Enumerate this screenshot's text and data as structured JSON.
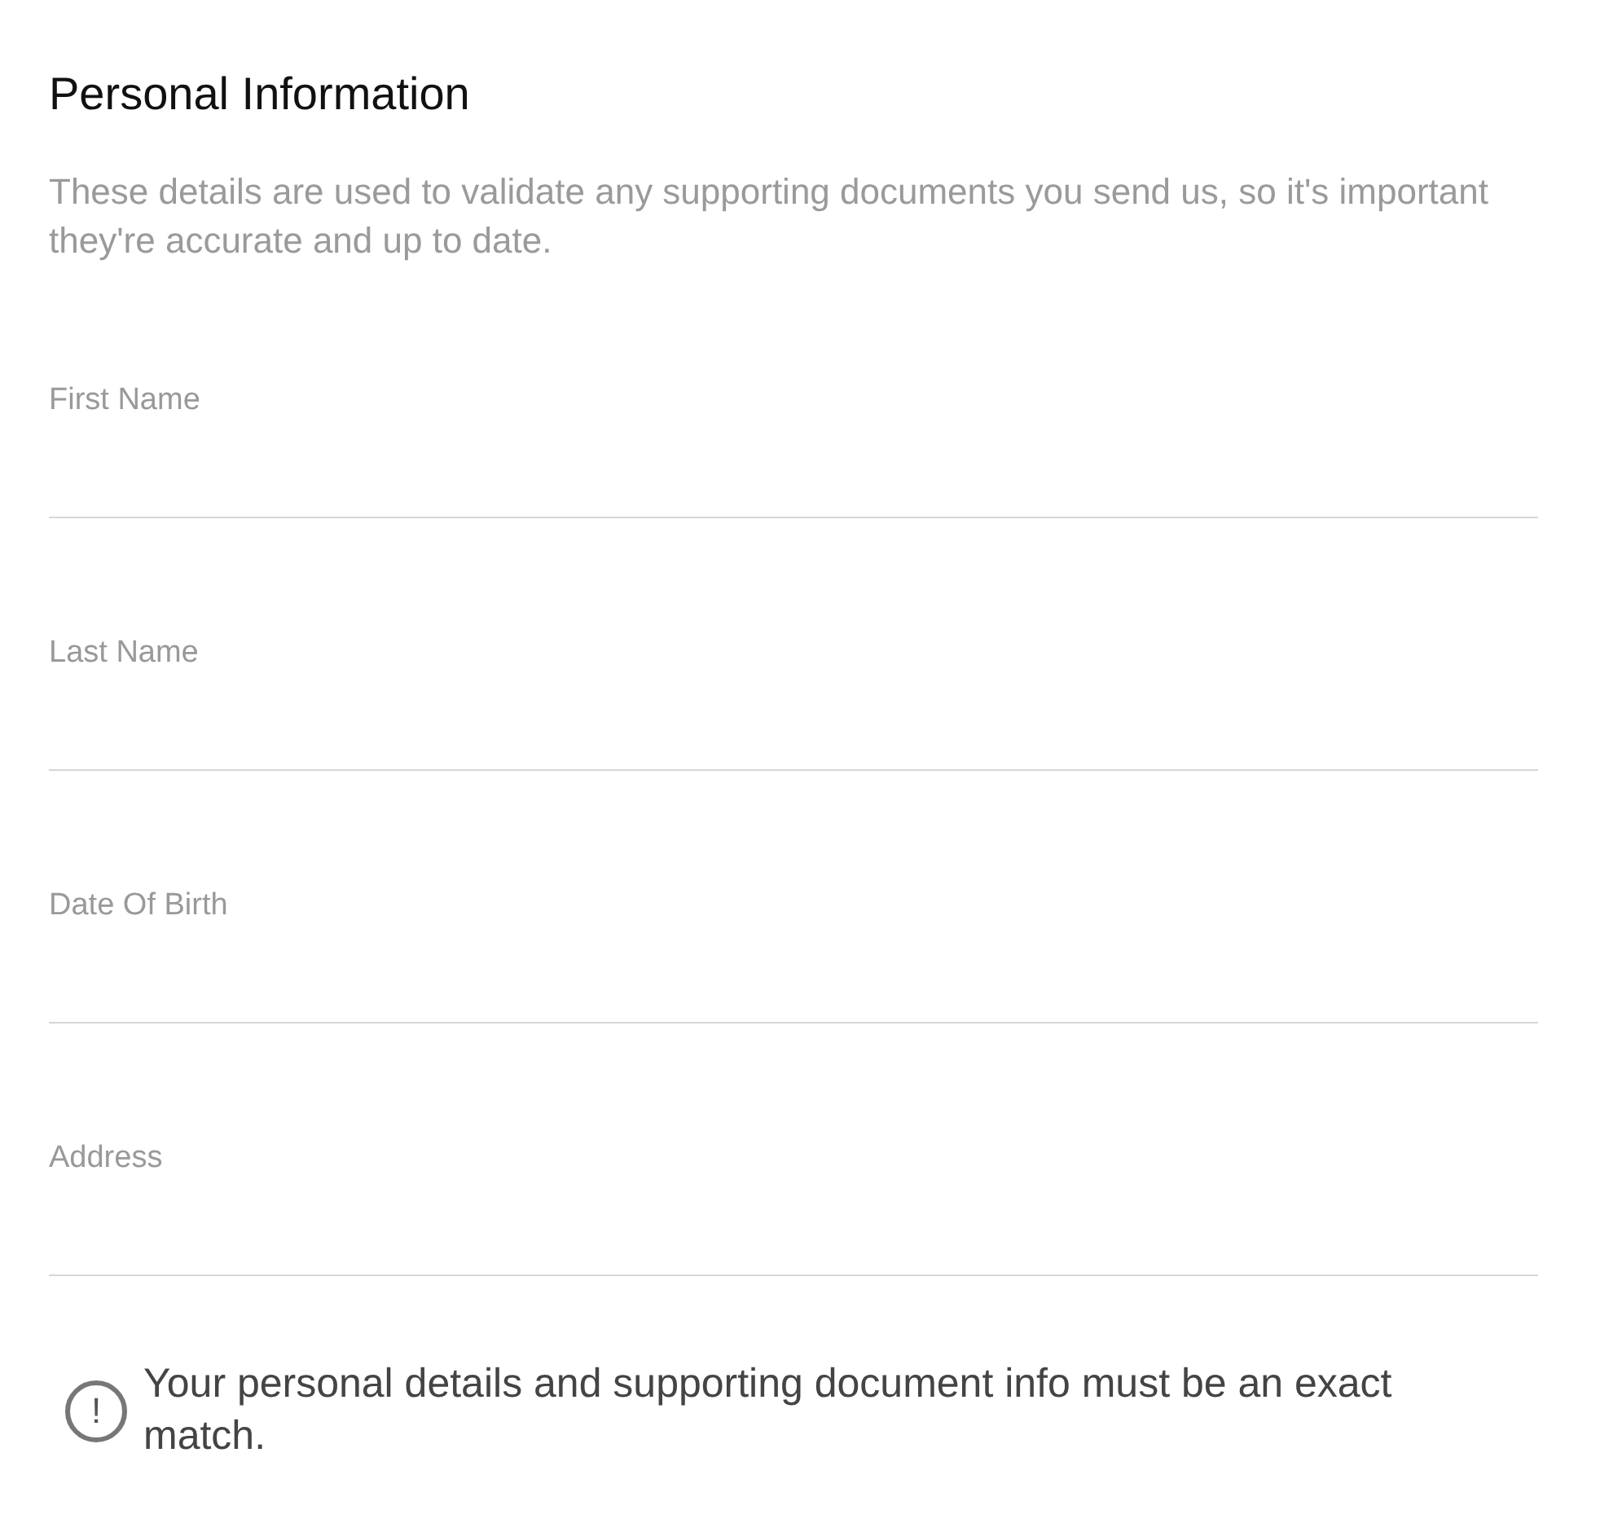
{
  "title": "Personal Information",
  "description": "These details are used to validate any supporting documents you send us, so it's important they're accurate and up to date.",
  "fields": [
    {
      "label": "First Name"
    },
    {
      "label": "Last Name"
    },
    {
      "label": "Date Of Birth"
    },
    {
      "label": "Address"
    }
  ],
  "notice": {
    "icon": "!",
    "text": "Your personal details and supporting document info must be an exact match."
  }
}
